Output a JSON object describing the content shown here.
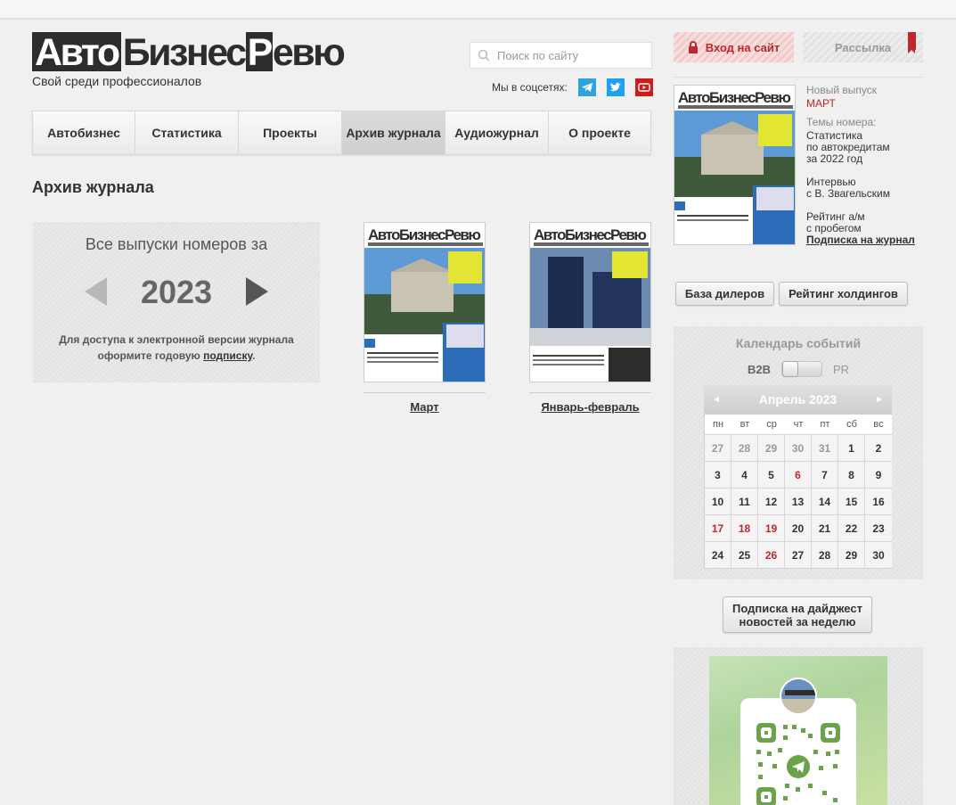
{
  "header": {
    "logo_part1": "Авто",
    "logo_part2": "Бизнес",
    "logo_part3": "Р",
    "logo_part4": "евю",
    "tagline": "Свой среди профессионалов",
    "search_placeholder": "Поиск по сайту",
    "social_label": "Мы в соцсетях:",
    "social_icons": [
      "telegram-icon",
      "twitter-icon",
      "youtube-icon"
    ]
  },
  "nav": {
    "tabs": [
      {
        "label": "Автобизнес"
      },
      {
        "label": "Статистика"
      },
      {
        "label": "Проекты"
      },
      {
        "label": "Архив журнала"
      },
      {
        "label": "Аудиожурнал"
      },
      {
        "label": "О проекте"
      }
    ],
    "active_index": 3
  },
  "main": {
    "page_title": "Архив журнала",
    "archive": {
      "title": "Все выпуски номеров за",
      "year": "2023",
      "note_line1": "Для доступа к электронной версии журнала",
      "note_line2_prefix": "оформите годовую ",
      "note_link": "подписку",
      "note_suffix": "."
    },
    "issues": [
      {
        "label": "Март"
      },
      {
        "label": "Январь-февраль"
      }
    ]
  },
  "sidebar": {
    "login_label": "Вход на сайт",
    "mailing_label": "Рассылка",
    "new_issue": {
      "label": "Новый выпуск",
      "month": "МАРТ",
      "topics_label": "Темы номера:",
      "topic1_l1": "Статистика",
      "topic1_l2": "по автокредитам",
      "topic1_l3": "за 2022 год",
      "topic2_l1": "Интервью",
      "topic2_l2": "с В. Звагельским",
      "topic3_l1": "Рейтинг а/м",
      "topic3_l2": "с пробегом",
      "subscribe_link": "Подписка на журнал"
    },
    "buttons": {
      "dealers": "База дилеров",
      "holdings": "Рейтинг холдингов",
      "digest_l1": "Подписка на дайджест",
      "digest_l2": "новостей за неделю"
    },
    "calendar": {
      "title": "Календарь событий",
      "toggle_left": "B2B",
      "toggle_right": "PR",
      "month": "Апрель 2023",
      "prev": "◄",
      "next": "►",
      "weekdays": [
        "пн",
        "вт",
        "ср",
        "чт",
        "пт",
        "сб",
        "вс"
      ],
      "days": [
        {
          "d": "27",
          "t": "other"
        },
        {
          "d": "28",
          "t": "other"
        },
        {
          "d": "29",
          "t": "other"
        },
        {
          "d": "30",
          "t": "other"
        },
        {
          "d": "31",
          "t": "other"
        },
        {
          "d": "1",
          "t": ""
        },
        {
          "d": "2",
          "t": ""
        },
        {
          "d": "3",
          "t": ""
        },
        {
          "d": "4",
          "t": ""
        },
        {
          "d": "5",
          "t": ""
        },
        {
          "d": "6",
          "t": "red"
        },
        {
          "d": "7",
          "t": ""
        },
        {
          "d": "8",
          "t": ""
        },
        {
          "d": "9",
          "t": ""
        },
        {
          "d": "10",
          "t": ""
        },
        {
          "d": "11",
          "t": ""
        },
        {
          "d": "12",
          "t": ""
        },
        {
          "d": "13",
          "t": ""
        },
        {
          "d": "14",
          "t": ""
        },
        {
          "d": "15",
          "t": ""
        },
        {
          "d": "16",
          "t": ""
        },
        {
          "d": "17",
          "t": "red"
        },
        {
          "d": "18",
          "t": "red"
        },
        {
          "d": "19",
          "t": "red"
        },
        {
          "d": "20",
          "t": ""
        },
        {
          "d": "21",
          "t": ""
        },
        {
          "d": "22",
          "t": ""
        },
        {
          "d": "23",
          "t": ""
        },
        {
          "d": "24",
          "t": ""
        },
        {
          "d": "25",
          "t": ""
        },
        {
          "d": "26",
          "t": "red"
        },
        {
          "d": "27",
          "t": ""
        },
        {
          "d": "28",
          "t": ""
        },
        {
          "d": "29",
          "t": ""
        },
        {
          "d": "30",
          "t": ""
        }
      ]
    }
  },
  "colors": {
    "accent_red": "#c0262d",
    "telegram": "#2ea3dd",
    "twitter": "#1da1f2",
    "youtube": "#d21a1a"
  }
}
